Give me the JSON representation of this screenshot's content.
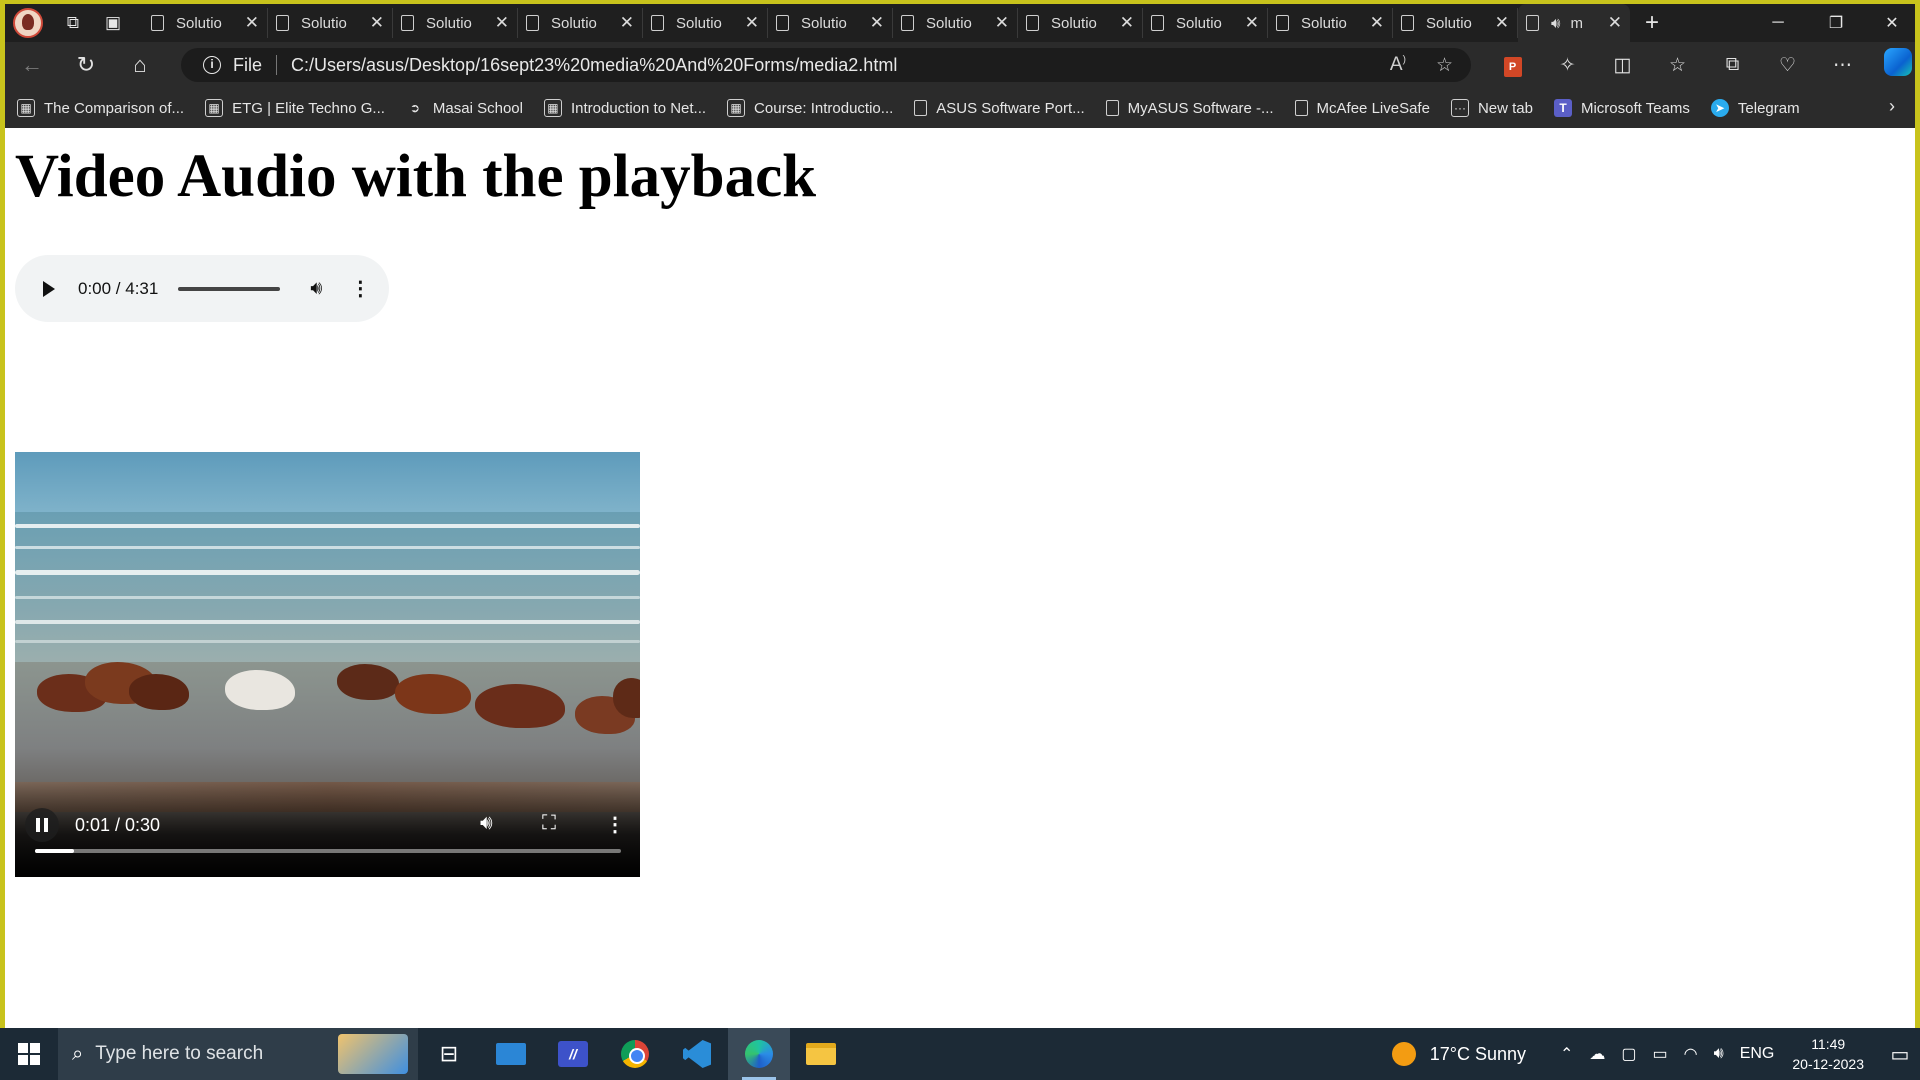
{
  "browser": {
    "tabs": [
      {
        "title": "Solutio"
      },
      {
        "title": "Solutio"
      },
      {
        "title": "Solutio"
      },
      {
        "title": "Solutio"
      },
      {
        "title": "Solutio"
      },
      {
        "title": "Solutio"
      },
      {
        "title": "Solutio"
      },
      {
        "title": "Solutio"
      },
      {
        "title": "Solutio"
      },
      {
        "title": "Solutio"
      },
      {
        "title": "Solutio"
      }
    ],
    "active_tab": {
      "title": "m"
    },
    "address": {
      "scheme_label": "File",
      "url": "C:/Users/asus/Desktop/16sept23%20media%20And%20Forms/media2.html"
    },
    "favorites": [
      {
        "label": "The Comparison of...",
        "icon": "site-icon"
      },
      {
        "label": "ETG | Elite Techno G...",
        "icon": "site-icon"
      },
      {
        "label": "Masai School",
        "icon": "masai-icon"
      },
      {
        "label": "Introduction to Net...",
        "icon": "site-icon"
      },
      {
        "label": "Course: Introductio...",
        "icon": "site-icon"
      },
      {
        "label": "ASUS Software Port...",
        "icon": "doc-icon"
      },
      {
        "label": "MyASUS Software -...",
        "icon": "doc-icon"
      },
      {
        "label": "McAfee LiveSafe",
        "icon": "doc-icon"
      },
      {
        "label": "New tab",
        "icon": "newtab-icon"
      },
      {
        "label": "Microsoft Teams",
        "icon": "teams-icon"
      },
      {
        "label": "Telegram",
        "icon": "telegram-icon"
      }
    ]
  },
  "page": {
    "title": "Video Audio with the playback",
    "audio": {
      "time": "0:00 / 4:31",
      "progress": 0
    },
    "video": {
      "time": "0:01 / 0:30",
      "progress": 0.067
    }
  },
  "taskbar": {
    "search_placeholder": "Type here to search",
    "weather": "17°C  Sunny",
    "language": "ENG",
    "time": "11:49",
    "date": "20-12-2023"
  },
  "colors": {
    "accent": "#c8c31c",
    "tab_bg": "#1f1f1f",
    "toolbar_bg": "#2b2b2b"
  }
}
